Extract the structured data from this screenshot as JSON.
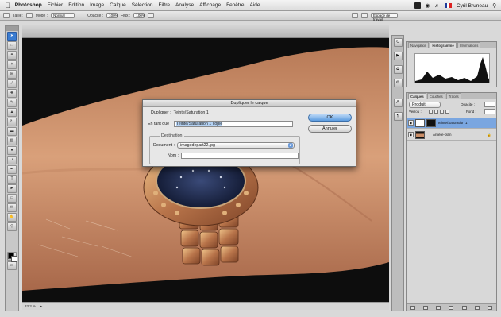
{
  "menubar": {
    "app_name": "Photoshop",
    "items": [
      "Fichier",
      "Edition",
      "Image",
      "Calque",
      "Sélection",
      "Filtre",
      "Analyse",
      "Affichage",
      "Fenêtre",
      "Aide"
    ],
    "user": "Cyril Bruneau"
  },
  "options_bar": {
    "labels": [
      "Taille:",
      "Mode :",
      "Opacité :",
      "Flux :"
    ],
    "mode_value": "Normal",
    "opacity_value": "100%",
    "flow_value": "100%",
    "workspace": "Espace de travail"
  },
  "dialog": {
    "title": "Dupliquer le calque",
    "duplicate_label": "Dupliquer :",
    "duplicate_value": "Teinte/Saturation 1",
    "as_label": "En tant que :",
    "as_value": "Teinte/Saturation 1 copie",
    "destination_label": "Destination",
    "document_label": "Document :",
    "document_value": "imagedepart22.jpg",
    "name_label": "Nom :",
    "name_value": "",
    "ok_label": "OK",
    "cancel_label": "Annuler"
  },
  "panels": {
    "top_tabs": [
      "Navigation",
      "Histogramme",
      "Informations"
    ],
    "layer_tabs": [
      "Calques",
      "Couches",
      "Tracés"
    ],
    "blend_mode": "Produit",
    "opacity_label": "Opacité :",
    "lock_label": "Verrou :",
    "fill_label": "Fond :",
    "layers": [
      {
        "name": "Teinte/Saturation 1",
        "selected": true
      },
      {
        "name": "Arrière-plan",
        "selected": false
      }
    ]
  },
  "status": {
    "zoom": "33,3 %"
  },
  "colors": {
    "selection_blue": "#3a7cd1",
    "dialog_bg": "#e7e7e7",
    "skin": "#c98d67"
  }
}
